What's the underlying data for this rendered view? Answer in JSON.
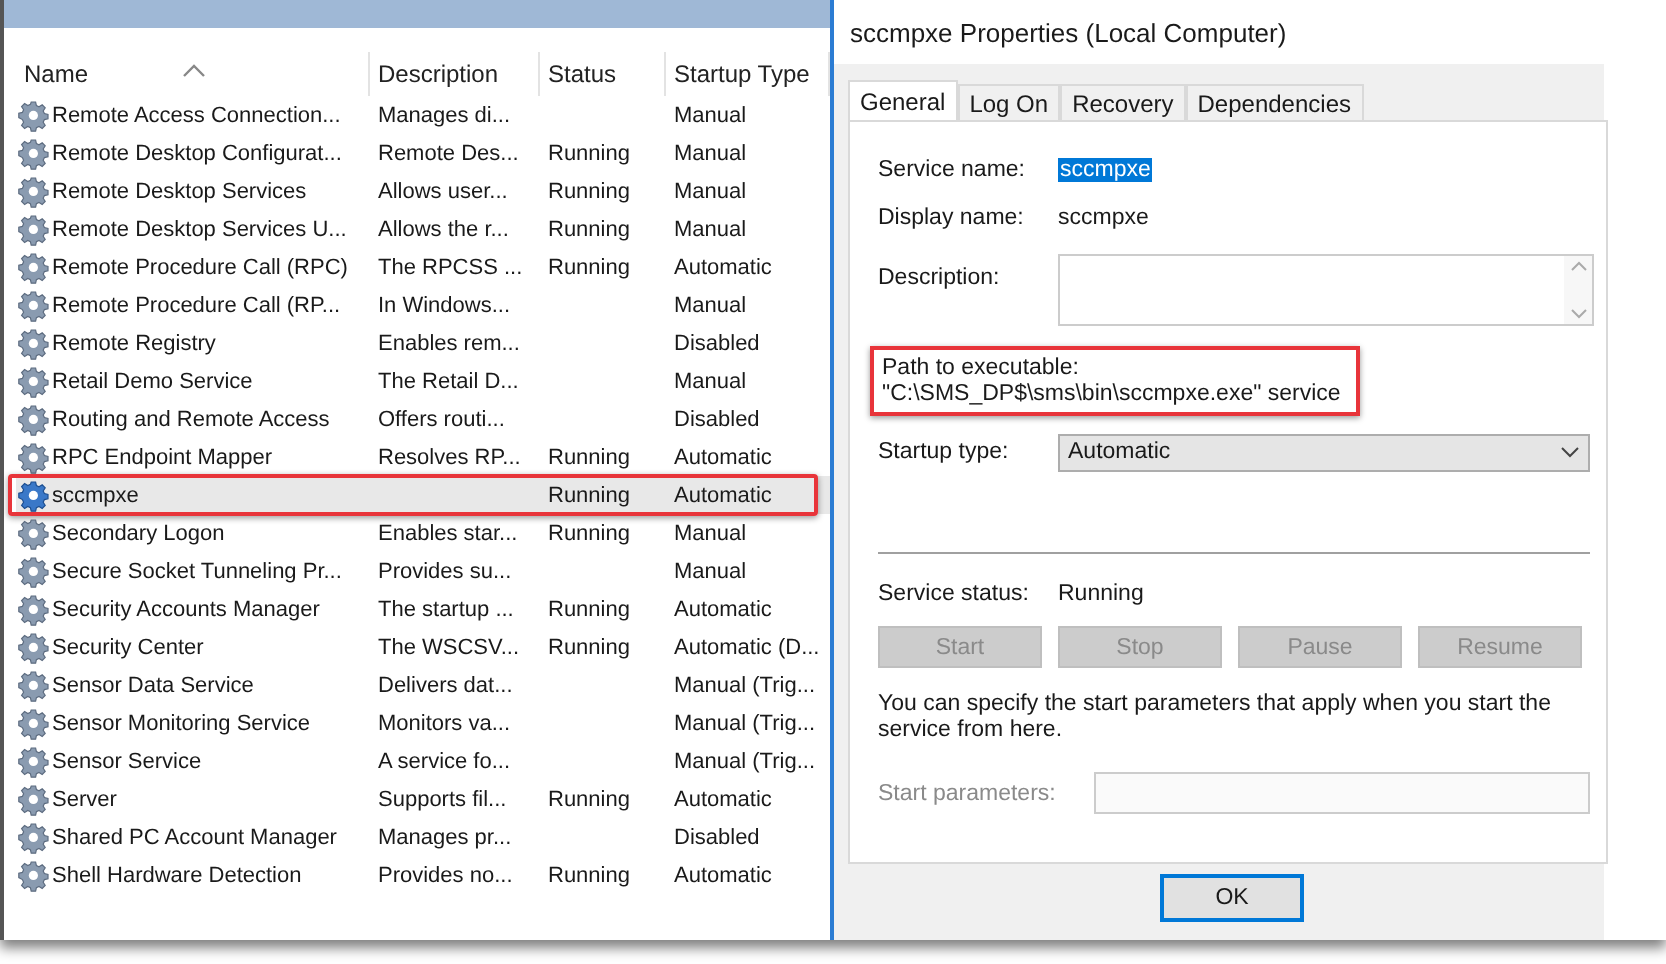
{
  "services": {
    "columns": [
      "Name",
      "Description",
      "Status",
      "Startup Type"
    ],
    "rows": [
      {
        "name": "Remote Access Connection...",
        "description": "Manages di...",
        "status": "",
        "startup": "Manual",
        "selected": false,
        "highlighted": false
      },
      {
        "name": "Remote Desktop Configurat...",
        "description": "Remote Des...",
        "status": "Running",
        "startup": "Manual",
        "selected": false,
        "highlighted": false
      },
      {
        "name": "Remote Desktop Services",
        "description": "Allows user...",
        "status": "Running",
        "startup": "Manual",
        "selected": false,
        "highlighted": false
      },
      {
        "name": "Remote Desktop Services U...",
        "description": "Allows the r...",
        "status": "Running",
        "startup": "Manual",
        "selected": false,
        "highlighted": false
      },
      {
        "name": "Remote Procedure Call (RPC)",
        "description": "The RPCSS ...",
        "status": "Running",
        "startup": "Automatic",
        "selected": false,
        "highlighted": false
      },
      {
        "name": "Remote Procedure Call (RP...",
        "description": "In Windows...",
        "status": "",
        "startup": "Manual",
        "selected": false,
        "highlighted": false
      },
      {
        "name": "Remote Registry",
        "description": "Enables rem...",
        "status": "",
        "startup": "Disabled",
        "selected": false,
        "highlighted": false
      },
      {
        "name": "Retail Demo Service",
        "description": "The Retail D...",
        "status": "",
        "startup": "Manual",
        "selected": false,
        "highlighted": false
      },
      {
        "name": "Routing and Remote Access",
        "description": "Offers routi...",
        "status": "",
        "startup": "Disabled",
        "selected": false,
        "highlighted": false
      },
      {
        "name": "RPC Endpoint Mapper",
        "description": "Resolves RP...",
        "status": "Running",
        "startup": "Automatic",
        "selected": false,
        "highlighted": false
      },
      {
        "name": "sccmpxe",
        "description": "",
        "status": "Running",
        "startup": "Automatic",
        "selected": true,
        "highlighted": true
      },
      {
        "name": "Secondary Logon",
        "description": "Enables star...",
        "status": "Running",
        "startup": "Manual",
        "selected": false,
        "highlighted": false
      },
      {
        "name": "Secure Socket Tunneling Pr...",
        "description": "Provides su...",
        "status": "",
        "startup": "Manual",
        "selected": false,
        "highlighted": false
      },
      {
        "name": "Security Accounts Manager",
        "description": "The startup ...",
        "status": "Running",
        "startup": "Automatic",
        "selected": false,
        "highlighted": false
      },
      {
        "name": "Security Center",
        "description": "The WSCSV...",
        "status": "Running",
        "startup": "Automatic (D...",
        "selected": false,
        "highlighted": false
      },
      {
        "name": "Sensor Data Service",
        "description": "Delivers dat...",
        "status": "",
        "startup": "Manual (Trig...",
        "selected": false,
        "highlighted": false
      },
      {
        "name": "Sensor Monitoring Service",
        "description": "Monitors va...",
        "status": "",
        "startup": "Manual (Trig...",
        "selected": false,
        "highlighted": false
      },
      {
        "name": "Sensor Service",
        "description": "A service fo...",
        "status": "",
        "startup": "Manual (Trig...",
        "selected": false,
        "highlighted": false
      },
      {
        "name": "Server",
        "description": "Supports fil...",
        "status": "Running",
        "startup": "Automatic",
        "selected": false,
        "highlighted": false
      },
      {
        "name": "Shared PC Account Manager",
        "description": "Manages pr...",
        "status": "",
        "startup": "Disabled",
        "selected": false,
        "highlighted": false
      },
      {
        "name": "Shell Hardware Detection",
        "description": "Provides no...",
        "status": "Running",
        "startup": "Automatic",
        "selected": false,
        "highlighted": false
      }
    ]
  },
  "dialog": {
    "title": "sccmpxe Properties (Local Computer)",
    "tabs": [
      {
        "label": "General",
        "selected": true
      },
      {
        "label": "Log On",
        "selected": false
      },
      {
        "label": "Recovery",
        "selected": false
      },
      {
        "label": "Dependencies",
        "selected": false
      }
    ],
    "service_name": {
      "label": "Service name:",
      "value": "sccmpxe"
    },
    "display_name": {
      "label": "Display name:",
      "value": "sccmpxe"
    },
    "description": {
      "label": "Description:"
    },
    "path": {
      "label": "Path to executable:",
      "value": "\"C:\\SMS_DP$\\sms\\bin\\sccmpxe.exe\" service",
      "highlighted": true
    },
    "startup_type": {
      "label": "Startup type:",
      "value": "Automatic"
    },
    "service_status": {
      "label": "Service status:",
      "value": "Running"
    },
    "buttons": [
      {
        "label": "Start",
        "disabled": true
      },
      {
        "label": "Stop",
        "disabled": true
      },
      {
        "label": "Pause",
        "disabled": true
      },
      {
        "label": "Resume",
        "disabled": true
      }
    ],
    "hint": "You can specify the start parameters that apply when you start the service from here.",
    "start_parameters": {
      "label": "Start parameters:",
      "disabled": true
    },
    "ok_button": "OK"
  }
}
